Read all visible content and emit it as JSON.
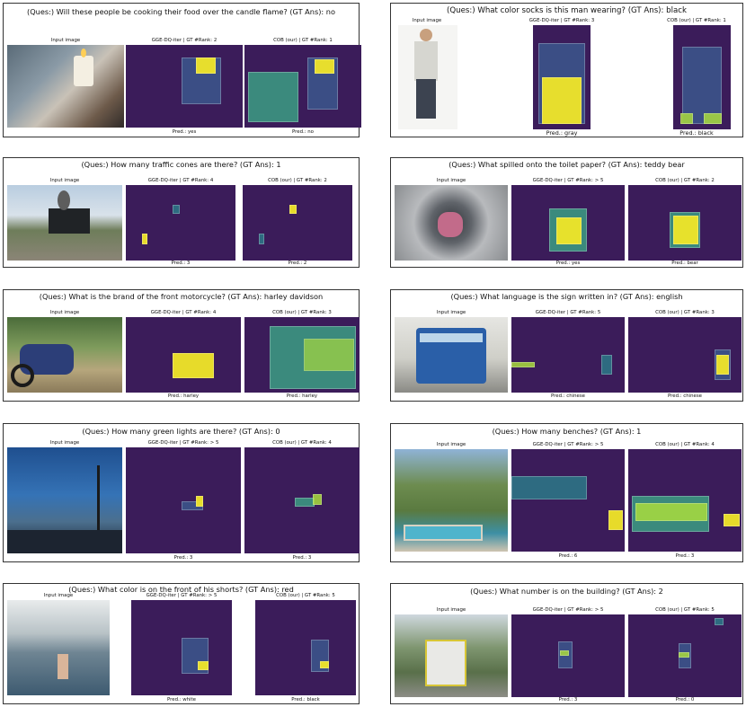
{
  "panels": [
    {
      "question": "(Ques:) Will these people be cooking their food over the candle flame?  (GT Ans): no",
      "col1": "Input image",
      "col2": "GGE-DQ-iter | GT #Rank: 2",
      "col3": "COB (our) | GT #Rank: 1",
      "pred2": "Pred.: yes",
      "pred3": "Pred.: no"
    },
    {
      "question": "(Ques:) What color socks is this man wearing?  (GT Ans): black",
      "col1": "Input image",
      "col2": "GGE-DQ-iter | GT #Rank: 3",
      "col3": "COB (our) | GT #Rank: 1",
      "pred2": "Pred.: gray",
      "pred3": "Pred.: black"
    },
    {
      "question": "(Ques:) How many traffic cones are there?  (GT Ans): 1",
      "col1": "Input image",
      "col2": "GGE-DQ-iter | GT #Rank: 4",
      "col3": "COB (our) | GT #Rank: 2",
      "pred2": "Pred.: 3",
      "pred3": "Pred.: 2"
    },
    {
      "question": "(Ques:) What spilled onto the toilet paper?  (GT Ans): teddy bear",
      "col1": "Input image",
      "col2": "GGE-DQ-iter | GT #Rank: > 5",
      "col3": "COB (our) | GT #Rank: 2",
      "pred2": "Pred.: yes",
      "pred3": "Pred.: bear"
    },
    {
      "question": "(Ques:) What is the brand of the front motorcycle?  (GT Ans): harley davidson",
      "col1": "Input image",
      "col2": "GGE-DQ-iter | GT #Rank: 4",
      "col3": "COB (our) | GT #Rank: 3",
      "pred2": "Pred.: harley",
      "pred3": "Pred.: harley"
    },
    {
      "question": "(Ques:) What language is the sign written in?  (GT Ans): english",
      "col1": "Input image",
      "col2": "GGE-DQ-iter | GT #Rank: 5",
      "col3": "COB (our) | GT #Rank: 3",
      "pred2": "Pred.: chinese",
      "pred3": "Pred.: chinese"
    },
    {
      "question": "(Ques:) How many green lights are there?  (GT Ans): 0",
      "col1": "Input image",
      "col2": "GGE-DQ-iter | GT #Rank: > 5",
      "col3": "COB (our) | GT #Rank: 4",
      "pred2": "Pred.: 3",
      "pred3": "Pred.: 3"
    },
    {
      "question": "(Ques:) How many benches?  (GT Ans): 1",
      "col1": "Input image",
      "col2": "GGE-DQ-iter | GT #Rank: > 5",
      "col3": "COB (our) | GT #Rank: 4",
      "pred2": "Pred.: 6",
      "pred3": "Pred.: 3"
    },
    {
      "question": "(Ques:) What color is on the front of his shorts?  (GT Ans): red",
      "col1": "Input image",
      "col2": "GGE-DQ-iter | GT #Rank: > 5",
      "col3": "COB (our) | GT #Rank: 5",
      "pred2": "Pred.: white",
      "pred3": "Pred.: black"
    },
    {
      "question": "(Ques:) What number is on the building?  (GT Ans): 2",
      "col1": "Input image",
      "col2": "GGE-DQ-iter | GT #Rank: > 5",
      "col3": "COB (our) | GT #Rank: 5",
      "pred2": "Pred.: 3",
      "pred3": "Pred.: 0"
    }
  ],
  "colors": {
    "heatmap_base": "#3b1c5a",
    "attention_high": "#f0e628",
    "attention_mid": "#3cb98c"
  }
}
